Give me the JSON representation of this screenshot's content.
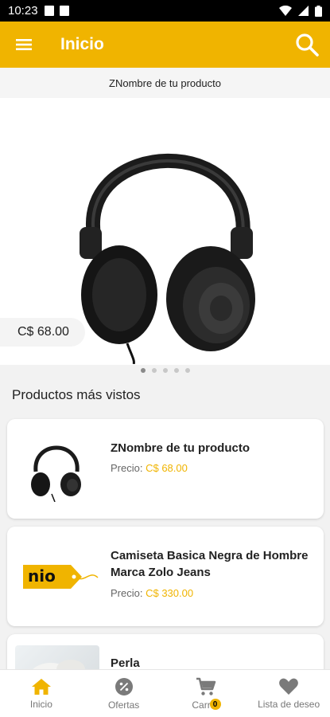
{
  "status_bar": {
    "time": "10:23"
  },
  "app_bar": {
    "title": "Inicio"
  },
  "featured": {
    "name": "ZNombre de tu producto",
    "price": "C$ 68.00"
  },
  "section_title": "Productos más vistos",
  "price_prefix": "Precio:",
  "products": [
    {
      "name": "ZNombre de tu producto",
      "price": "C$ 68.00"
    },
    {
      "name": "Camiseta Basica Negra de Hombre Marca Zolo Jeans",
      "price": "C$ 330.00",
      "logo_text": "nio"
    },
    {
      "name": "Perla"
    }
  ],
  "bottom_nav": {
    "items": [
      {
        "label": "Inicio",
        "icon": "home-icon"
      },
      {
        "label": "Ofertas",
        "icon": "percent-badge-icon"
      },
      {
        "label": "Carrito",
        "icon": "cart-icon",
        "badge": "0"
      },
      {
        "label": "Lista de deseo",
        "icon": "heart-icon"
      }
    ]
  },
  "colors": {
    "accent": "#f0b400",
    "muted_icon": "#7a7a7a"
  }
}
